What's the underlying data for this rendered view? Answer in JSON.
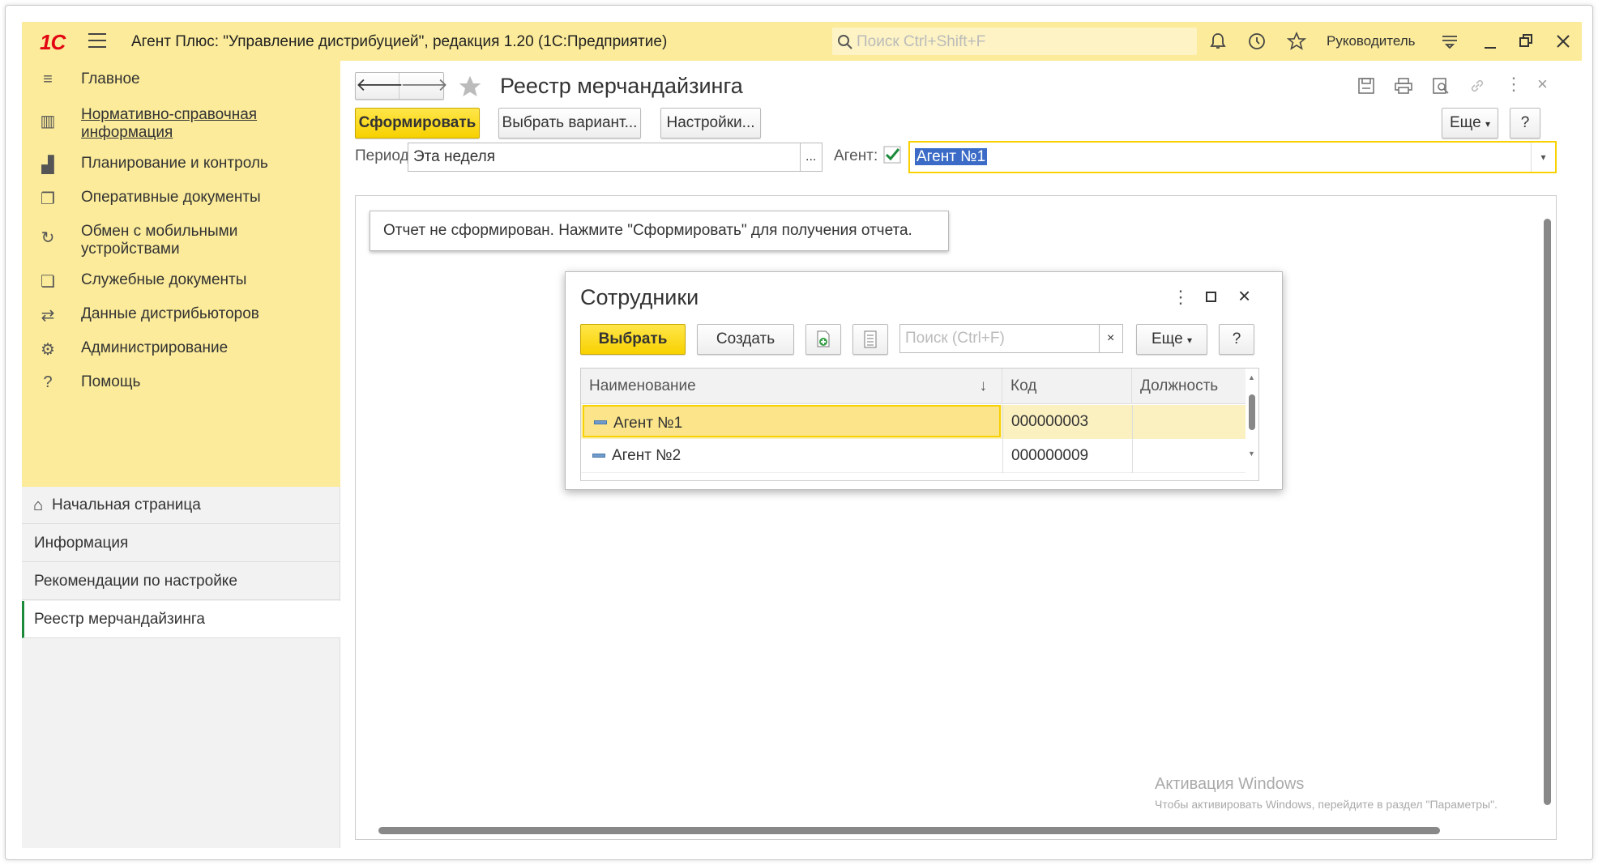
{
  "titlebar": {
    "logo": "1С",
    "app_title": "Агент Плюс: \"Управление дистрибуцией\", редакция 1.20  (1С:Предприятие)",
    "search_placeholder": "Поиск Ctrl+Shift+F",
    "user": "Руководитель"
  },
  "sidebar": {
    "sections": [
      {
        "label": "Главное",
        "icon": "menu-lines-icon"
      },
      {
        "label": "Нормативно-справочная информация",
        "icon": "reference-books-icon",
        "underlined": true
      },
      {
        "label": "Планирование и контроль",
        "icon": "chart-bars-icon"
      },
      {
        "label": "Оперативные документы",
        "icon": "documents-icon"
      },
      {
        "label": "Обмен с мобильными устройствами",
        "icon": "sync-icon"
      },
      {
        "label": "Служебные документы",
        "icon": "service-docs-icon"
      },
      {
        "label": "Данные дистрибьюторов",
        "icon": "distributor-icon"
      },
      {
        "label": "Администрирование",
        "icon": "gear-icon"
      },
      {
        "label": "Помощь",
        "icon": "question-icon"
      }
    ],
    "nav": [
      {
        "label": "Начальная страница",
        "icon": "home-icon"
      },
      {
        "label": "Информация"
      },
      {
        "label": "Рекомендации по настройке"
      },
      {
        "label": "Реестр мерчандайзинга",
        "active": true
      }
    ]
  },
  "main": {
    "title": "Реестр мерчандайзинга",
    "buttons": {
      "generate": "Сформировать",
      "choose_variant": "Выбрать вариант...",
      "settings": "Настройки...",
      "more": "Еще",
      "help": "?"
    },
    "period_label": "Период:",
    "period_value": "Эта неделя",
    "period_choose": "...",
    "agent_label": "Агент:",
    "agent_value": "Агент №1",
    "notice": "Отчет не сформирован. Нажмите \"Сформировать\" для получения отчета.",
    "watermark_title": "Активация Windows",
    "watermark_text": "Чтобы активировать Windows, перейдите в раздел \"Параметры\"."
  },
  "dialog": {
    "title": "Сотрудники",
    "buttons": {
      "select": "Выбрать",
      "create": "Создать",
      "more": "Еще",
      "help": "?"
    },
    "search_placeholder": "Поиск (Ctrl+F)",
    "search_clear": "×",
    "columns": [
      "Наименование",
      "Код",
      "Должность"
    ],
    "sort_indicator": "↓",
    "rows": [
      {
        "name": "Агент №1",
        "code": "000000003",
        "position": "",
        "selected": true
      },
      {
        "name": "Агент №2",
        "code": "000000009",
        "position": ""
      }
    ]
  },
  "colors": {
    "accent_yellow": "#fbeb9a",
    "button_yellow": "#f7d100",
    "active_green": "#1b8a3a",
    "logo_red": "#e30613"
  }
}
